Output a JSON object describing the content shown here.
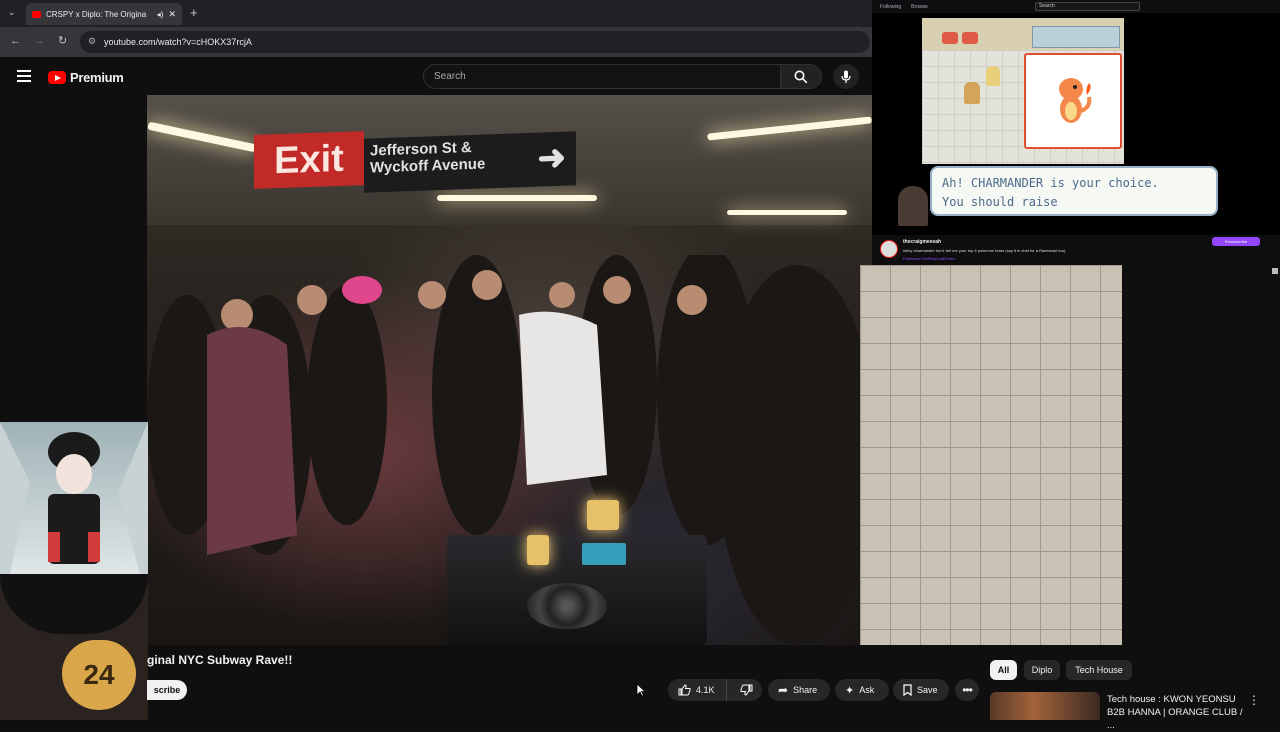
{
  "browser": {
    "tab_title": "CRSPY x Diplo: The Origina",
    "url": "youtube.com/watch?v=cHOKX37rcjA"
  },
  "youtube": {
    "logo_text": "Premium",
    "search_placeholder": "Search"
  },
  "video": {
    "exit_sign": "Exit",
    "street_sign_line1": "Jefferson St &",
    "street_sign_line2": "Wyckoff Avenue",
    "title_visible": "ginal NYC Subway Rave!!",
    "subscribe_label": "scribe",
    "like_count": "4.1K",
    "share_label": "Share",
    "ask_label": "Ask",
    "save_label": "Save"
  },
  "overlay_left": {
    "badge_text": "24"
  },
  "stream": {
    "topbar_items": [
      "Following",
      "Browse"
    ],
    "search_placeholder": "Search",
    "dialog_line1": "Ah! CHARMANDER is your choice.",
    "dialog_line2": "You should raise",
    "streamer_name": "thecraigmeeeah",
    "stream_title": "shiny charmander hunt. tell me your top 6 pokemon team (say it in chat for a Rambeast too)",
    "stream_tags": "Pokémon FireRed/LeafGreen",
    "subscribe_label": "Resubscribe"
  },
  "recommendations": {
    "chips": [
      "All",
      "Diplo",
      "Tech House"
    ],
    "first_title": "Tech house : KWON YEONSU B2B HANNA | ORANGE CLUB / ..."
  },
  "colors": {
    "yt_red": "#ff0000",
    "twitch_purple": "#9147ff",
    "exit_red": "#c22a28"
  }
}
